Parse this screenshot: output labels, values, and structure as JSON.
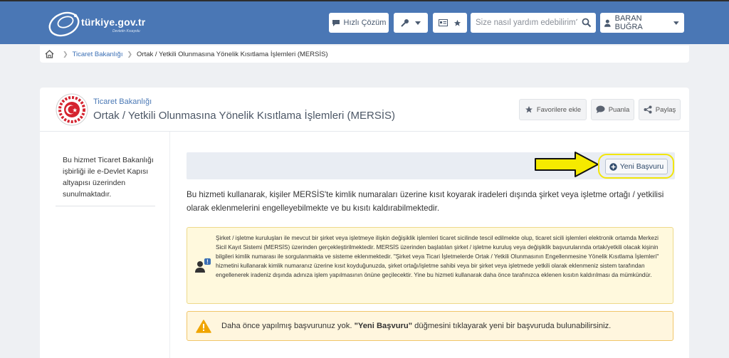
{
  "header": {
    "logo_text": "türkiye.gov.tr",
    "logo_tagline": "Devletin Kısayolu",
    "hizli_cozum_label": "Hızlı Çözüm",
    "search_placeholder": "Size nasıl yardım edebilirim?",
    "user_name": "BARAN BUĞRA"
  },
  "breadcrumb": {
    "items": [
      "Ticaret Bakanlığı",
      "Ortak / Yetkili Olunmasına Yönelik Kısıtlama İşlemleri (MERSİS)"
    ]
  },
  "service": {
    "ministry": "Ticaret Bakanlığı",
    "title": "Ortak / Yetkili Olunmasına Yönelik Kısıtlama İşlemleri (MERSİS)",
    "actions": {
      "favorite": "Favorilere ekle",
      "rate": "Puanla",
      "share": "Paylaş"
    }
  },
  "sidebar": {
    "info": "Bu hizmet Ticaret Bakanlığı işbirliği ile e-Devlet Kapısı altyapısı üzerinden sunulmaktadır."
  },
  "main": {
    "new_application_label": "Yeni Başvuru",
    "intro": "Bu hizmeti kullanarak, kişiler MERSİS'te kimlik numaraları üzerine kısıt koyarak iradeleri dışında şirket veya işletme ortağı / yetkilisi olarak eklenmelerini engelleyebilmekte ve bu kısıtı kaldırabilmektedir.",
    "notice": "Şirket / işletme kuruluşları ile mevcut bir şirket veya işletmeye ilişkin değişiklik işlemleri ticaret sicilinde tescil edilmekte olup, ticaret sicili işlemleri elektronik ortamda Merkezi Sicil Kayıt Sistemi (MERSİS) üzerinden gerçekleştirilmektedir. MERSİS üzerinden başlatılan şirket / işletme kuruluş veya değişiklik başvurularında ortak/yetkili olacak kişinin bilgileri kimlik numarası ile sorgulanmakta ve sisteme eklenmektedir. \"Şirket veya Ticari İşletmelerde Ortak / Yetkili Olunmasının Engellenmesine Yönelik Kısıtlama İşlemleri\" hizmetini kullanarak kimlik numaranız üzerine kısıt koyduğunuzda, şirket ortağı/işletme sahibi veya bir şirket veya işletmede yetkili olarak eklenmeniz sistem tarafından engellenerek iradeniz dışında adınıza işlem yapılmasının önüne geçilecektir. Yine bu hizmeti kullanarak daha önce tarafınızca eklenen kısıtın kaldırılması da mümkündür.",
    "warning_prefix": "Daha önce yapılmış başvurunuz yok. ",
    "warning_bold": "\"Yeni Başvuru\"",
    "warning_suffix": " düğmesini tıklayarak yeni bir başvuruda bulunabilirsiniz."
  },
  "colors": {
    "header_bg": "#4a77b5",
    "highlight": "#f2e60a",
    "link": "#3a6fb5",
    "warning": "#f0a500"
  }
}
